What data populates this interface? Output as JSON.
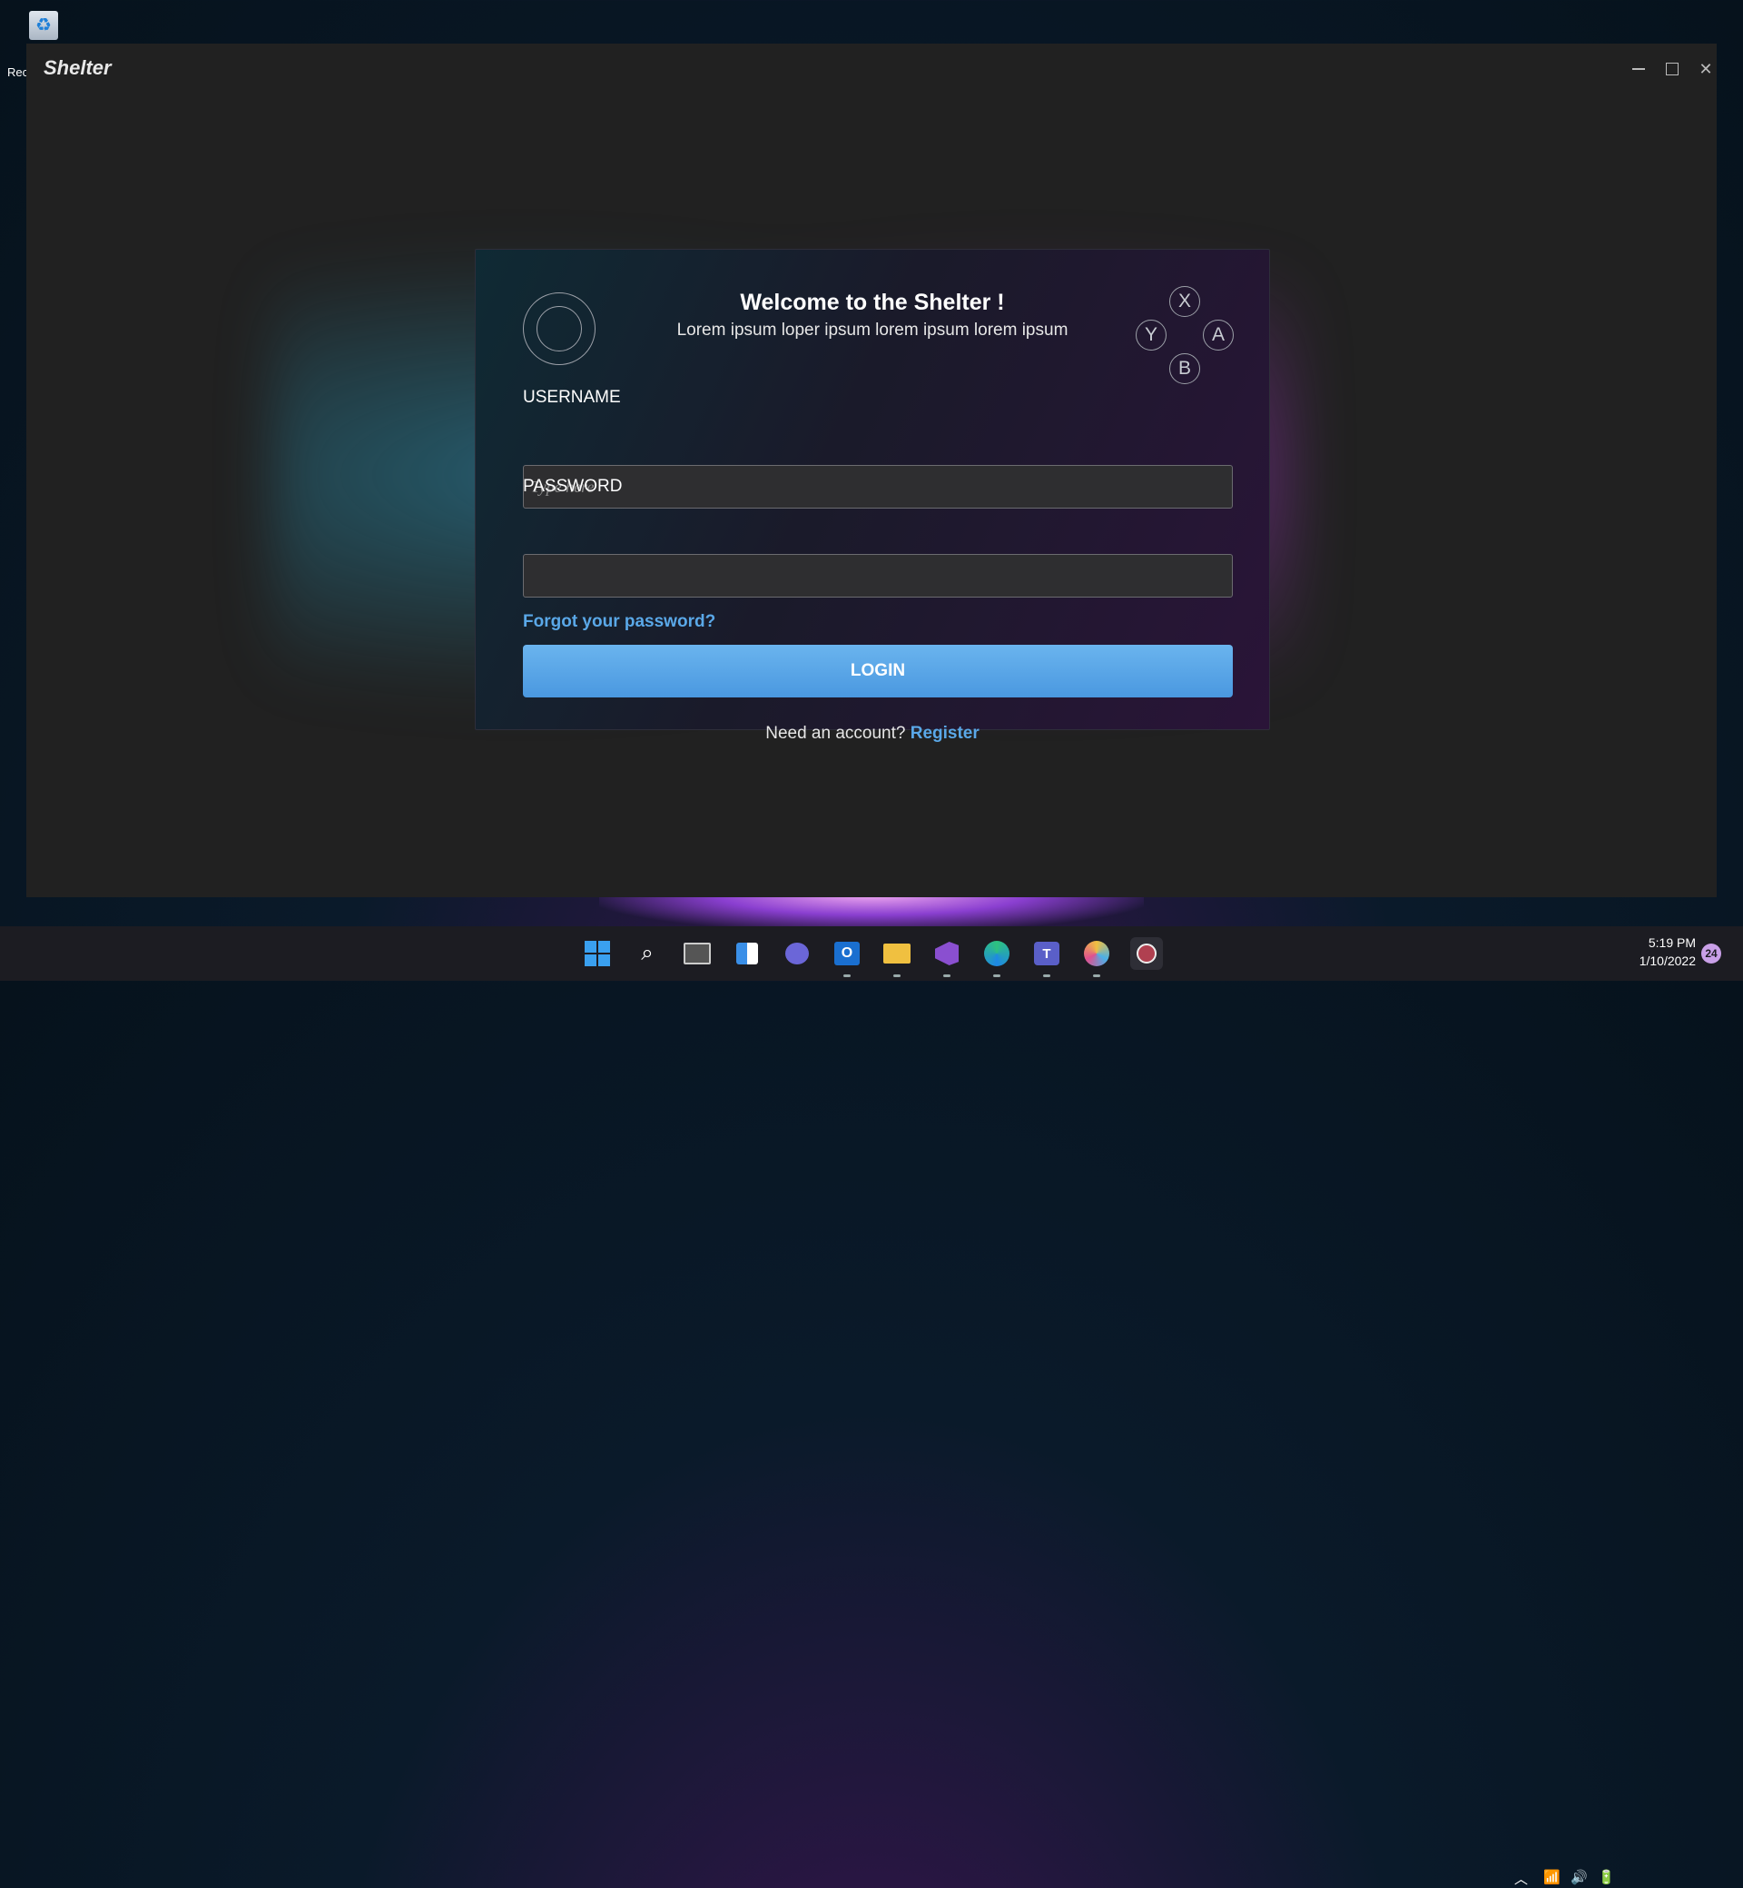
{
  "desktop": {
    "recycle_label": "Rec"
  },
  "window": {
    "title": "Shelter",
    "controls": {
      "minimize": "—",
      "maximize": "□",
      "close": "✕"
    }
  },
  "login": {
    "welcome": "Welcome to the Shelter !",
    "subtitle": "Lorem ipsum loper ipsum lorem ipsum lorem ipsum",
    "face_buttons": {
      "x": "X",
      "y": "Y",
      "a": "A",
      "b": "B"
    },
    "username_label": "USERNAME",
    "username_placeholder": "Type here",
    "username_value": "",
    "password_label": "PASSWORD",
    "password_value": "",
    "forgot": "Forgot your password?",
    "login_button": "LOGIN",
    "need_account": "Need an account?",
    "register": "Register"
  },
  "taskbar": {
    "apps": [
      "start-icon",
      "search-icon",
      "task-view-icon",
      "widgets-icon",
      "chat-icon",
      "outlook-icon",
      "file-explorer-icon",
      "visual-studio-icon",
      "edge-icon",
      "teams-icon",
      "maps-icon",
      "shelter-app-icon"
    ],
    "time": "5:19 PM",
    "date": "1/10/2022",
    "notification_count": "24"
  },
  "colors": {
    "accent": "#5aa8e8",
    "button": "#5aa8e8",
    "window_bg": "#212121"
  }
}
